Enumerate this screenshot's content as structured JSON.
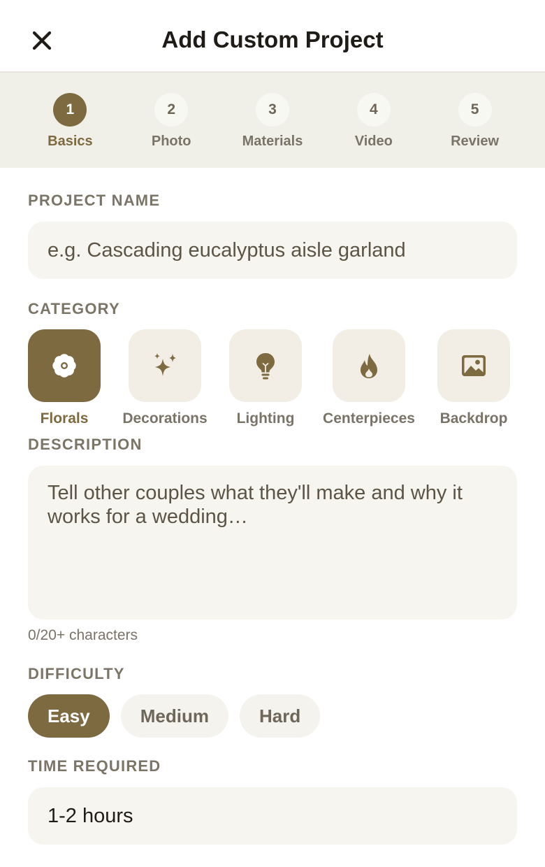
{
  "header": {
    "title": "Add Custom Project",
    "close_icon": "close-icon"
  },
  "colors": {
    "accent": "#7d6a40",
    "stepper_bg": "#f0f0e8",
    "field_bg": "#f7f5ef",
    "muted_text": "#7a7468"
  },
  "steps": [
    {
      "number": "1",
      "label": "Basics",
      "active": true
    },
    {
      "number": "2",
      "label": "Photo",
      "active": false
    },
    {
      "number": "3",
      "label": "Materials",
      "active": false
    },
    {
      "number": "4",
      "label": "Video",
      "active": false
    },
    {
      "number": "5",
      "label": "Review",
      "active": false
    }
  ],
  "form": {
    "name_label": "PROJECT NAME",
    "name_placeholder": "e.g. Cascading eucalyptus aisle garland",
    "category_label": "CATEGORY",
    "categories": [
      {
        "label": "Florals",
        "icon": "flower-icon",
        "active": true
      },
      {
        "label": "Decorations",
        "icon": "sparkles-icon",
        "active": false
      },
      {
        "label": "Lighting",
        "icon": "lightbulb-icon",
        "active": false
      },
      {
        "label": "Centerpieces",
        "icon": "flame-icon",
        "active": false
      },
      {
        "label": "Backdrop",
        "icon": "image-icon",
        "active": false
      }
    ],
    "description_label": "DESCRIPTION",
    "description_placeholder": "Tell other couples what they'll make and why it works for a wedding…",
    "char_count": "0/20+ characters",
    "difficulty_label": "DIFFICULTY",
    "difficulty_options": [
      {
        "label": "Easy",
        "active": true
      },
      {
        "label": "Medium",
        "active": false
      },
      {
        "label": "Hard",
        "active": false
      }
    ],
    "time_label": "TIME REQUIRED",
    "time_value": "1-2 hours"
  }
}
